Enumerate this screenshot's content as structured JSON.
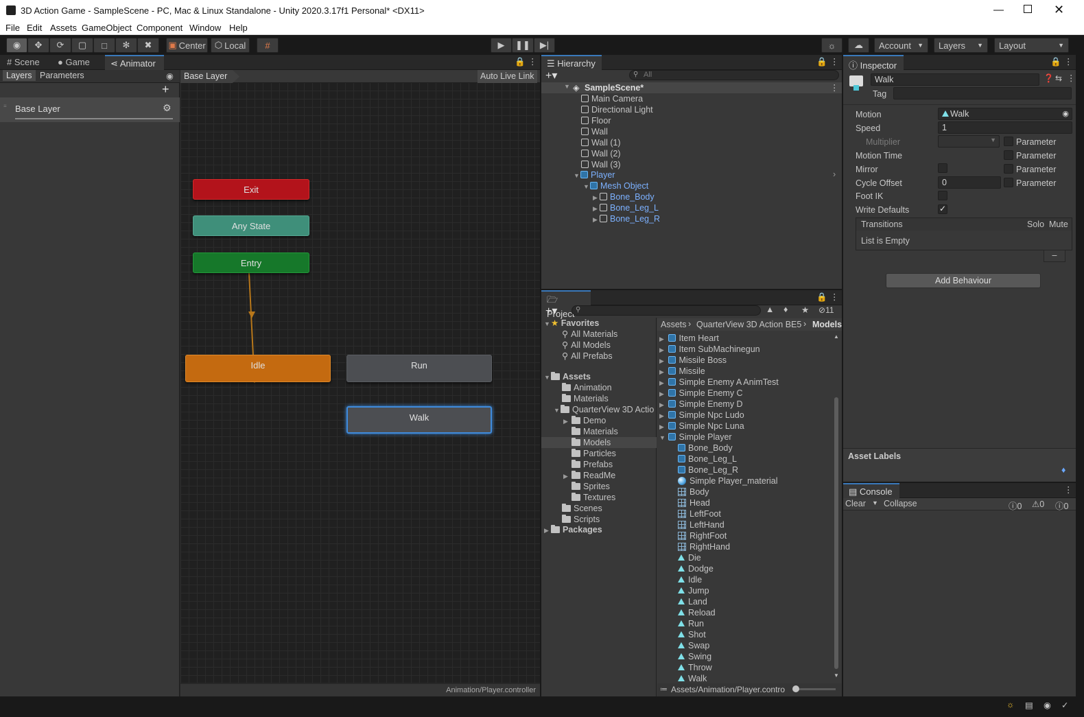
{
  "window": {
    "title": "3D Action Game - SampleScene - PC, Mac & Linux Standalone - Unity 2020.3.17f1 Personal* <DX11>"
  },
  "menu": [
    "File",
    "Edit",
    "Assets",
    "GameObject",
    "Component",
    "Window",
    "Help"
  ],
  "toolbar": {
    "center": "Center",
    "local": "Local",
    "account": "Account",
    "layers": "Layers",
    "layout": "Layout"
  },
  "animator": {
    "tabs": [
      "Scene",
      "Game",
      "Animator"
    ],
    "subtabs": [
      "Layers",
      "Parameters"
    ],
    "base_layer_item": "Base Layer",
    "breadcrumb": "Base Layer",
    "auto_live_link": "Auto Live Link",
    "footer_path": "Animation/Player.controller",
    "states": {
      "exit": "Exit",
      "any": "Any State",
      "entry": "Entry",
      "idle": "Idle",
      "run": "Run",
      "walk": "Walk"
    }
  },
  "hierarchy": {
    "title": "Hierarchy",
    "search_placeholder": "All",
    "scene": "SampleScene*",
    "items": [
      "Main Camera",
      "Directional Light",
      "Floor",
      "Wall",
      "Wall (1)",
      "Wall (2)",
      "Wall (3)"
    ],
    "player": "Player",
    "mesh": "Mesh Object",
    "bones": [
      "Bone_Body",
      "Bone_Leg_L",
      "Bone_Leg_R"
    ]
  },
  "project": {
    "title": "Project",
    "hidden_count": "11",
    "breadcrumb": [
      "Assets",
      "QuarterView 3D Action BE5",
      "Models"
    ],
    "favorites": "Favorites",
    "fav_items": [
      "All Materials",
      "All Models",
      "All Prefabs"
    ],
    "assets": "Assets",
    "asset_folders": [
      "Animation",
      "Materials"
    ],
    "quarterview": "QuarterView 3D Actio",
    "qv_folders": [
      "Demo",
      "Materials",
      "Models",
      "Particles",
      "Prefabs",
      "ReadMe",
      "Sprites",
      "Textures"
    ],
    "other_folders": [
      "Scenes",
      "Scripts"
    ],
    "packages": "Packages",
    "prefab_items": [
      "Item Heart",
      "Item SubMachinegun",
      "Missile Boss",
      "Missile",
      "Simple Enemy A AnimTest",
      "Simple Enemy C",
      "Simple Enemy D",
      "Simple Npc Ludo",
      "Simple Npc Luna",
      "Simple Player"
    ],
    "sub_prefabs": [
      "Bone_Body",
      "Bone_Leg_L",
      "Bone_Leg_R"
    ],
    "material": "Simple Player_material",
    "meshes": [
      "Body",
      "Head",
      "LeftFoot",
      "LeftHand",
      "RightFoot",
      "RightHand"
    ],
    "clips": [
      "Die",
      "Dodge",
      "Idle",
      "Jump",
      "Land",
      "Reload",
      "Run",
      "Shot",
      "Swap",
      "Swing",
      "Throw",
      "Walk"
    ],
    "footer_path": "Assets/Animation/Player.contro"
  },
  "inspector": {
    "title": "Inspector",
    "name": "Walk",
    "tag_label": "Tag",
    "fields": {
      "motion_label": "Motion",
      "motion_value": "Walk",
      "speed_label": "Speed",
      "speed_value": "1",
      "multiplier_label": "Multiplier",
      "motion_time_label": "Motion Time",
      "mirror_label": "Mirror",
      "cycle_offset_label": "Cycle Offset",
      "cycle_offset_value": "0",
      "foot_ik_label": "Foot IK",
      "write_defaults_label": "Write Defaults",
      "parameter": "Parameter"
    },
    "transitions": {
      "title": "Transitions",
      "solo": "Solo",
      "mute": "Mute",
      "empty": "List is Empty"
    },
    "add_behaviour": "Add Behaviour",
    "asset_labels": "Asset Labels"
  },
  "console": {
    "title": "Console",
    "clear": "Clear",
    "collapse": "Collapse",
    "counts": [
      "0",
      "0",
      "0"
    ]
  }
}
